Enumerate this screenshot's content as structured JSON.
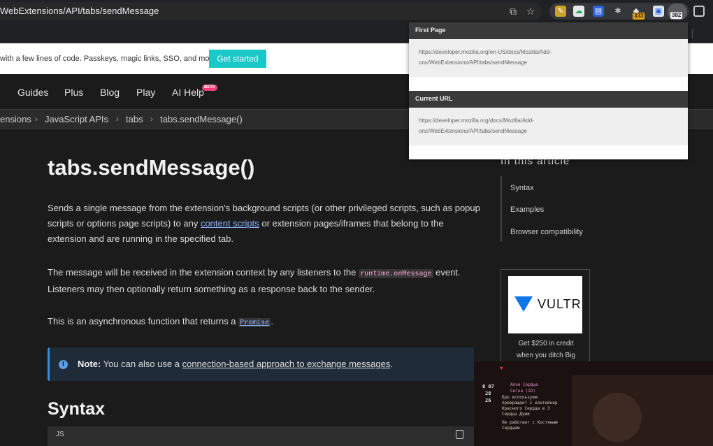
{
  "browser": {
    "url": "WebExtensions/API/tabs/sendMessage",
    "extension_badges": {
      "yellow": "333",
      "active": "382"
    }
  },
  "banner": {
    "text": "with a few lines of code. Passkeys, magic links, SSO, and more",
    "cta": "Get started"
  },
  "nav": {
    "items": [
      "Guides",
      "Plus",
      "Blog",
      "Play",
      "AI Help"
    ],
    "beta": "BETA"
  },
  "breadcrumb": [
    "ensions",
    "JavaScript APIs",
    "tabs",
    "tabs.sendMessage()"
  ],
  "article": {
    "title": "tabs.sendMessage()",
    "p1_a": "Sends a single message from the extension's background scripts (or other privileged scripts, such as popup scripts or options page scripts) to any ",
    "p1_link": "content scripts",
    "p1_b": " or extension pages/iframes that belong to the extension and are running in the specified tab.",
    "p2_a": "The message will be received in the extension context by any listeners to the ",
    "p2_code": "runtime.onMessage",
    "p2_b": " event. Listeners may then optionally return something as a response back to the sender.",
    "p3_a": "This is an asynchronous function that returns a ",
    "p3_code": "Promise",
    "p3_b": ".",
    "note_label": "Note:",
    "note_a": " You can also use a ",
    "note_link": "connection-based approach to exchange messages",
    "note_b": ".",
    "syntax_heading": "Syntax",
    "code_lang": "JS"
  },
  "toc": {
    "title": "In this article",
    "items": [
      "Syntax",
      "Examples",
      "Browser compatibility"
    ]
  },
  "ad": {
    "brand": "VULTR",
    "line1": "Get $250 in credit",
    "line2": "when you ditch Big"
  },
  "popup": {
    "first_label": "First Page",
    "first_url": "https://developer.mozilla.org/en-US/docs/Mozilla/Add-ons/WebExtensions/API/tabs/sendMessage",
    "current_label": "Current URL",
    "current_url": "https://developer.mozilla.org/docs/Mozilla/Add-ons/WebExtensions/API/tabs/sendMessage"
  },
  "game": {
    "counters": [
      "0 07",
      "28",
      "26"
    ],
    "lines": [
      "Алое Сердце",
      "Сигна (ID)",
      "Бро используем",
      "превращает 1 контейнер",
      "Красного Сердца в 3",
      "Сердца Души",
      "Не работает с Костяным",
      "Сердцем"
    ]
  }
}
